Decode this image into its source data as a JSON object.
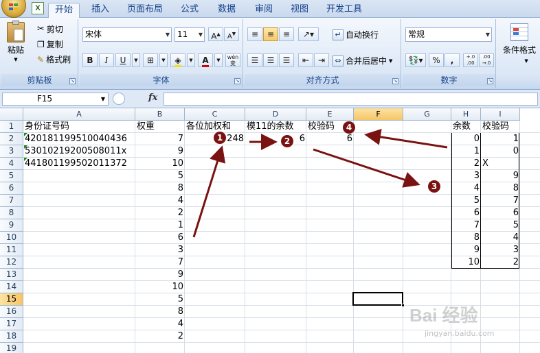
{
  "tabs": [
    "开始",
    "插入",
    "页面布局",
    "公式",
    "数据",
    "审阅",
    "视图",
    "开发工具"
  ],
  "ribbon": {
    "clipboard": {
      "label": "剪贴板",
      "paste": "粘贴",
      "cut": "剪切",
      "copy": "复制",
      "format_painter": "格式刷"
    },
    "font": {
      "label": "字体",
      "name": "宋体",
      "size": "11",
      "bold": "B",
      "italic": "I",
      "underline": "U",
      "phonetic": "wén\n变"
    },
    "alignment": {
      "label": "对齐方式",
      "wrap_text": "自动换行",
      "merge_center": "合并后居中"
    },
    "number": {
      "label": "数字",
      "format": "常规",
      "percent": "%",
      "comma": ",",
      "inc_decimal": "+.0\n.00",
      "dec_decimal": ".00\n→.0"
    },
    "styles": {
      "conditional_format": "条件格式"
    }
  },
  "formula_bar": {
    "name_box": "F15",
    "fx": "fx",
    "formula": ""
  },
  "sheet": {
    "columns": [
      "A",
      "B",
      "C",
      "D",
      "E",
      "F",
      "G",
      "H",
      "I"
    ],
    "rows": [
      "1",
      "2",
      "3",
      "4",
      "5",
      "6",
      "7",
      "8",
      "9",
      "10",
      "11",
      "12",
      "13",
      "14",
      "15",
      "16",
      "17",
      "18",
      "19"
    ],
    "headers": {
      "A1": "身份证号码",
      "B1": "权重",
      "C1": "各位加权和",
      "D1": "模11的余数",
      "E1": "校验码",
      "H1": "余数",
      "I1": "校验码"
    },
    "ids": [
      "420181199510040436",
      "53010219200508011x",
      "441801199502011372"
    ],
    "weights": [
      "7",
      "9",
      "10",
      "5",
      "8",
      "4",
      "2",
      "1",
      "6",
      "3",
      "7",
      "9",
      "10",
      "5",
      "8",
      "4",
      "2"
    ],
    "weighted_sum": "248",
    "mod11": "6",
    "check_code": "6",
    "lookup": {
      "remainders": [
        "0",
        "1",
        "2",
        "3",
        "4",
        "5",
        "6",
        "7",
        "8",
        "9",
        "10"
      ],
      "codes": [
        "1",
        "0",
        "X",
        "9",
        "8",
        "7",
        "6",
        "5",
        "4",
        "3",
        "2"
      ]
    }
  },
  "annotations": {
    "n1": "1",
    "n2": "2",
    "n3": "3",
    "n4": "4",
    "arrow_color": "#7a1212"
  },
  "watermark": {
    "brand": "Bai 经验",
    "url": "jingyan.baidu.com"
  }
}
